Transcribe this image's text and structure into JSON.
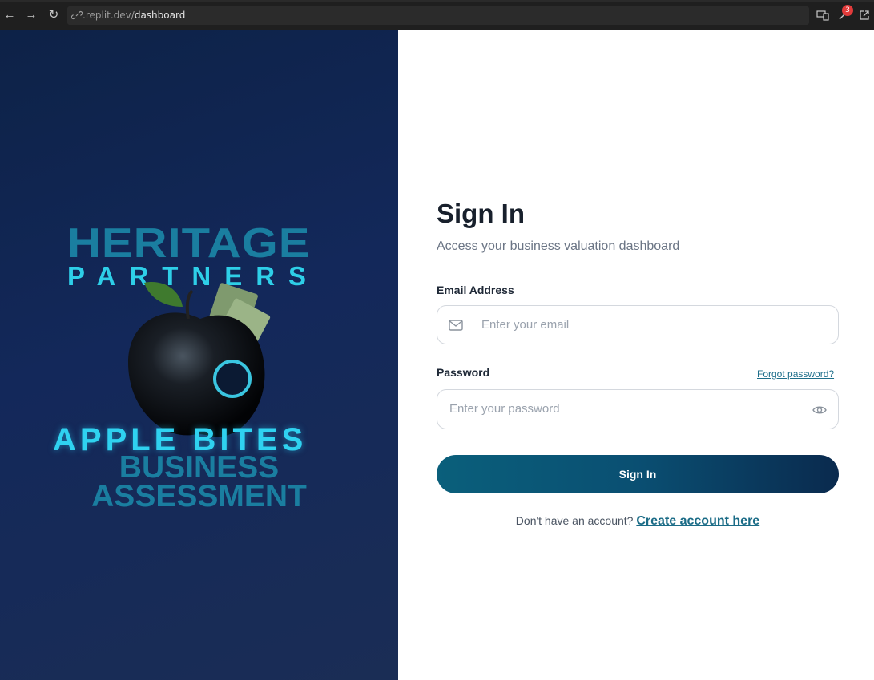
{
  "browser": {
    "url_host": ".replit.dev/",
    "url_path": "dashboard",
    "notification_count": "3"
  },
  "brand": {
    "line1": "HERITAGE",
    "line2": "PARTNERS",
    "line3": "APPLE BITES",
    "line4a": "BUSINESS",
    "line4b": "ASSESSMENT"
  },
  "form": {
    "title": "Sign In",
    "subtitle": "Access your business valuation dashboard",
    "email_label": "Email Address",
    "email_placeholder": "Enter your email",
    "password_label": "Password",
    "forgot_link": "Forgot password?",
    "password_placeholder": "Enter your password",
    "submit_label": "Sign In",
    "footer_prompt": "Don't have an account?",
    "footer_link": "Create account here"
  },
  "colors": {
    "accent": "#0a5f7b",
    "panel_bg": "#13285a",
    "brand_cyan": "#2ecfe8",
    "brand_teal": "#1a7ea0"
  }
}
